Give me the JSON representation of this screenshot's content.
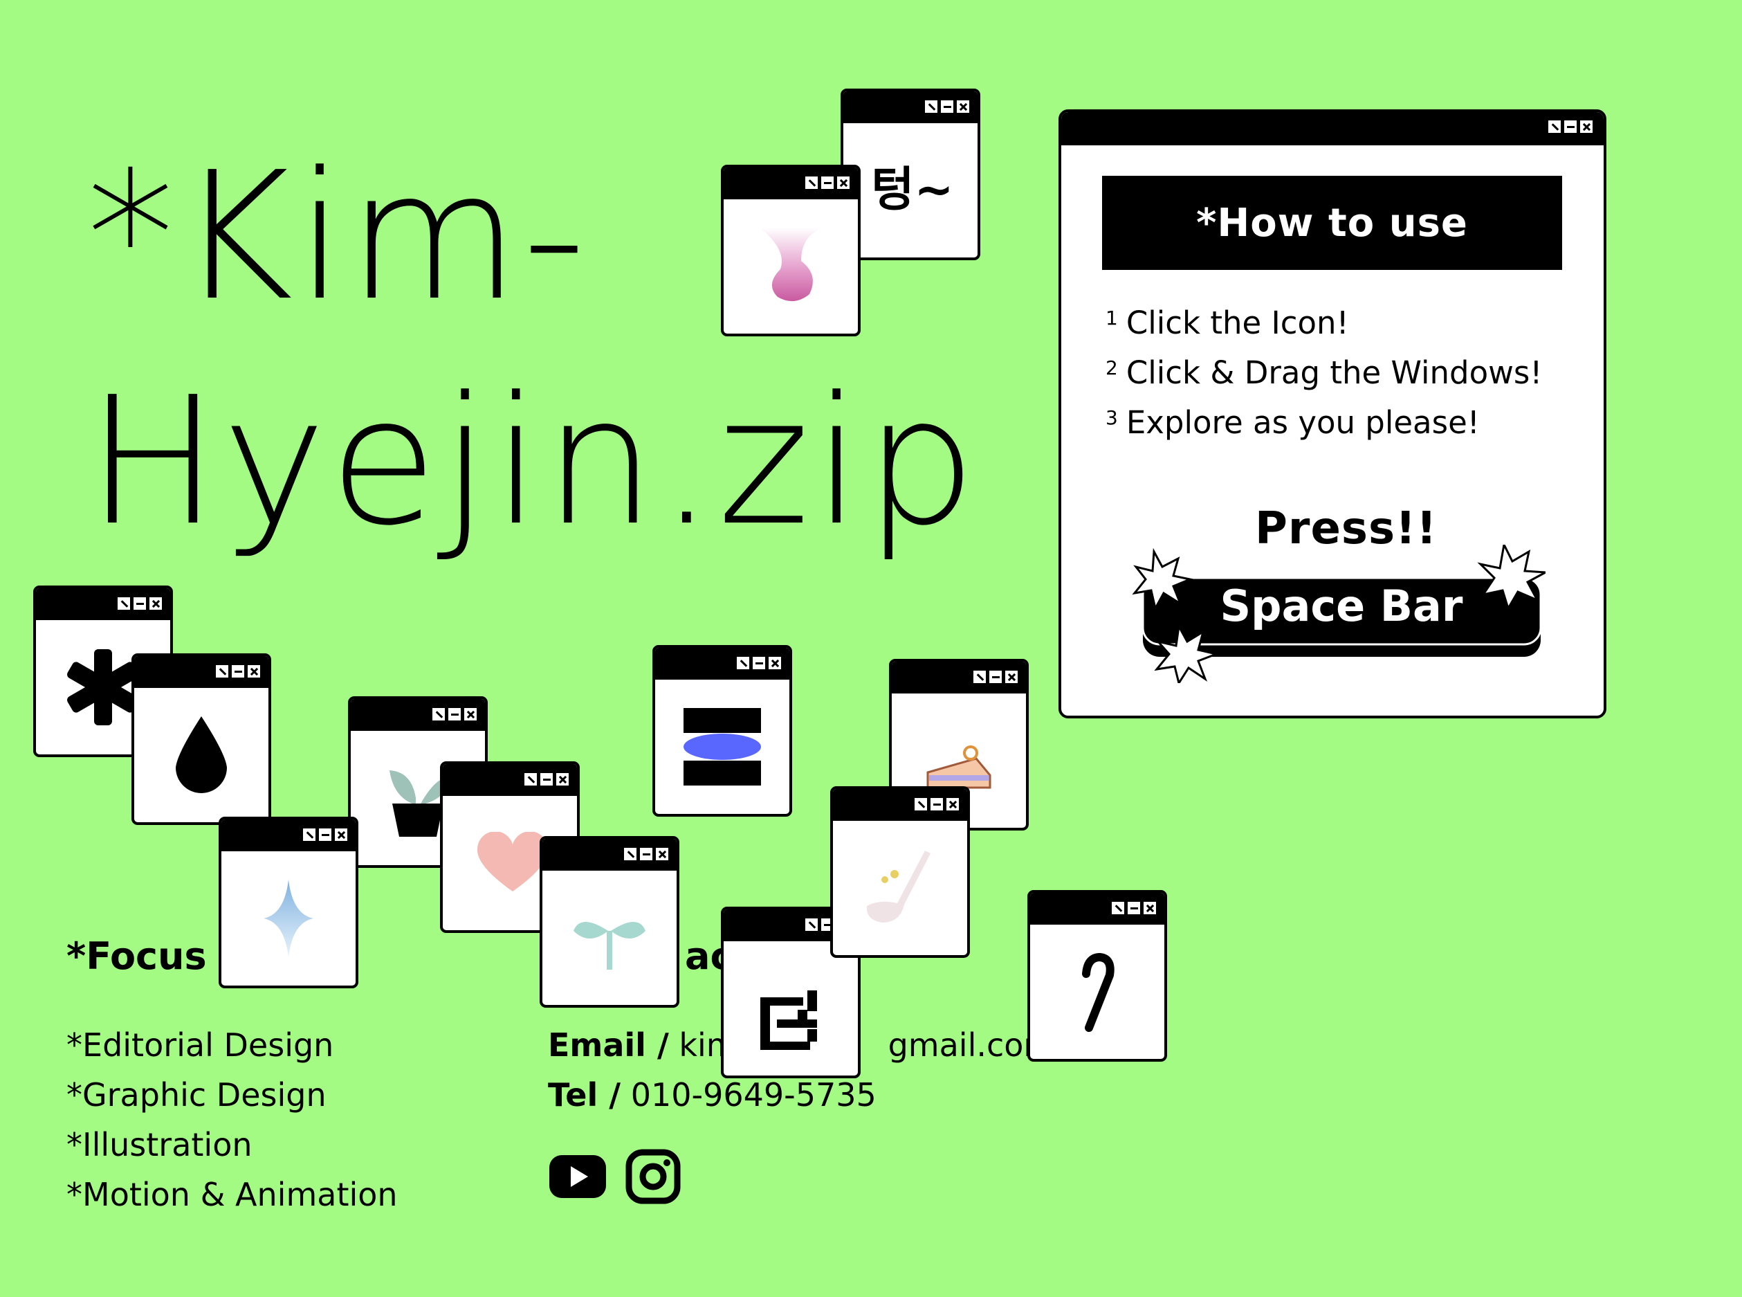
{
  "title": {
    "line1": "*Kim-",
    "line2": "Hyejin.zip"
  },
  "window_glyph_text": "텅~",
  "how_to": {
    "heading": "*How to use",
    "steps": [
      {
        "num": "1",
        "text": "Click the Icon!"
      },
      {
        "num": "2",
        "text": "Click & Drag the Windows!"
      },
      {
        "num": "3",
        "text": "Explore as you please!"
      }
    ],
    "press": "Press!!",
    "space_bar": "Space Bar"
  },
  "focus": {
    "heading": "*Focus",
    "items": [
      "*Editorial Design",
      "*Graphic Design",
      "*Illustration",
      "*Motion & Animation"
    ]
  },
  "contact": {
    "heading": "act",
    "email_label": "Email /",
    "email_value": "kim",
    "email_tail": "gmail.com",
    "tel_label": "Tel /",
    "tel_value": "010-9649-5735"
  },
  "social_icons": [
    "youtube-icon",
    "instagram-icon"
  ],
  "colors": {
    "background": "#a3fb84",
    "window": "#ffffff",
    "bar": "#000000"
  }
}
